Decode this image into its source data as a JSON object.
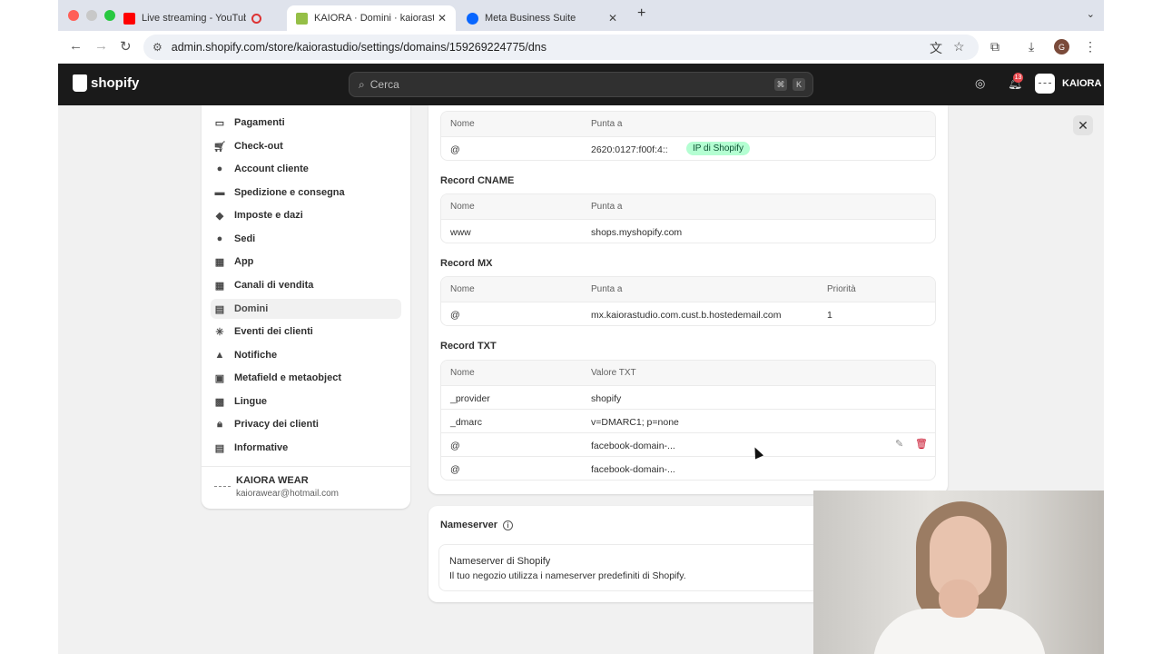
{
  "browser": {
    "tabs": [
      {
        "title": "Live streaming - YouTube",
        "color": "#ff0000"
      },
      {
        "title": "KAIORA · Domini · kaiorastudi",
        "color": "#95bf47"
      },
      {
        "title": "Meta Business Suite",
        "color": "#0866ff"
      }
    ],
    "url": "admin.shopify.com/store/kaiorastudio/settings/domains/159269224775/dns",
    "profile_initial": "G"
  },
  "shopify": {
    "logo_text": "shopify",
    "search_placeholder": "Cerca",
    "shortcut_cmd": "⌘",
    "shortcut_key": "K",
    "notifications_count": "13",
    "store_name": "KAIORA"
  },
  "sidebar": {
    "items": [
      {
        "label": "Pagamenti",
        "icon": "card-icon"
      },
      {
        "label": "Check-out",
        "icon": "cart-icon"
      },
      {
        "label": "Account cliente",
        "icon": "person-icon"
      },
      {
        "label": "Spedizione e consegna",
        "icon": "truck-icon"
      },
      {
        "label": "Imposte e dazi",
        "icon": "tax-icon"
      },
      {
        "label": "Sedi",
        "icon": "location-icon"
      },
      {
        "label": "App",
        "icon": "apps-icon"
      },
      {
        "label": "Canali di vendita",
        "icon": "channels-icon"
      },
      {
        "label": "Domini",
        "icon": "domain-icon"
      },
      {
        "label": "Eventi dei clienti",
        "icon": "events-icon"
      },
      {
        "label": "Notifiche",
        "icon": "bell-icon"
      },
      {
        "label": "Metafield e metaobject",
        "icon": "metafield-icon"
      },
      {
        "label": "Lingue",
        "icon": "language-icon"
      },
      {
        "label": "Privacy dei clienti",
        "icon": "lock-icon"
      },
      {
        "label": "Informative",
        "icon": "policy-icon"
      }
    ],
    "store": {
      "name": "KAIORA WEAR",
      "email": "kaiorawear@hotmail.com"
    }
  },
  "dns": {
    "a_records": {
      "col_name": "Nome",
      "col_points": "Punta a",
      "rows": [
        {
          "name": "@",
          "points": "2620:0127:f00f:4::",
          "badge": "IP di Shopify"
        }
      ]
    },
    "cname": {
      "title": "Record CNAME",
      "col_name": "Nome",
      "col_points": "Punta a",
      "rows": [
        {
          "name": "www",
          "points": "shops.myshopify.com"
        }
      ]
    },
    "mx": {
      "title": "Record MX",
      "col_name": "Nome",
      "col_points": "Punta a",
      "col_priority": "Priorità",
      "rows": [
        {
          "name": "@",
          "points": "mx.kaiorastudio.com.cust.b.hostedemail.com",
          "priority": "1"
        }
      ]
    },
    "txt": {
      "title": "Record TXT",
      "col_name": "Nome",
      "col_value": "Valore TXT",
      "rows": [
        {
          "name": "_provider",
          "value": "shopify"
        },
        {
          "name": "_dmarc",
          "value": "v=DMARC1; p=none"
        },
        {
          "name": "@",
          "value": "facebook-domain-..."
        },
        {
          "name": "@",
          "value": "facebook-domain-..."
        }
      ]
    }
  },
  "nameserver": {
    "title": "Nameserver",
    "box_title": "Nameserver di Shopify",
    "box_text": "Il tuo negozio utilizza i nameserver predefiniti di Shopify."
  }
}
